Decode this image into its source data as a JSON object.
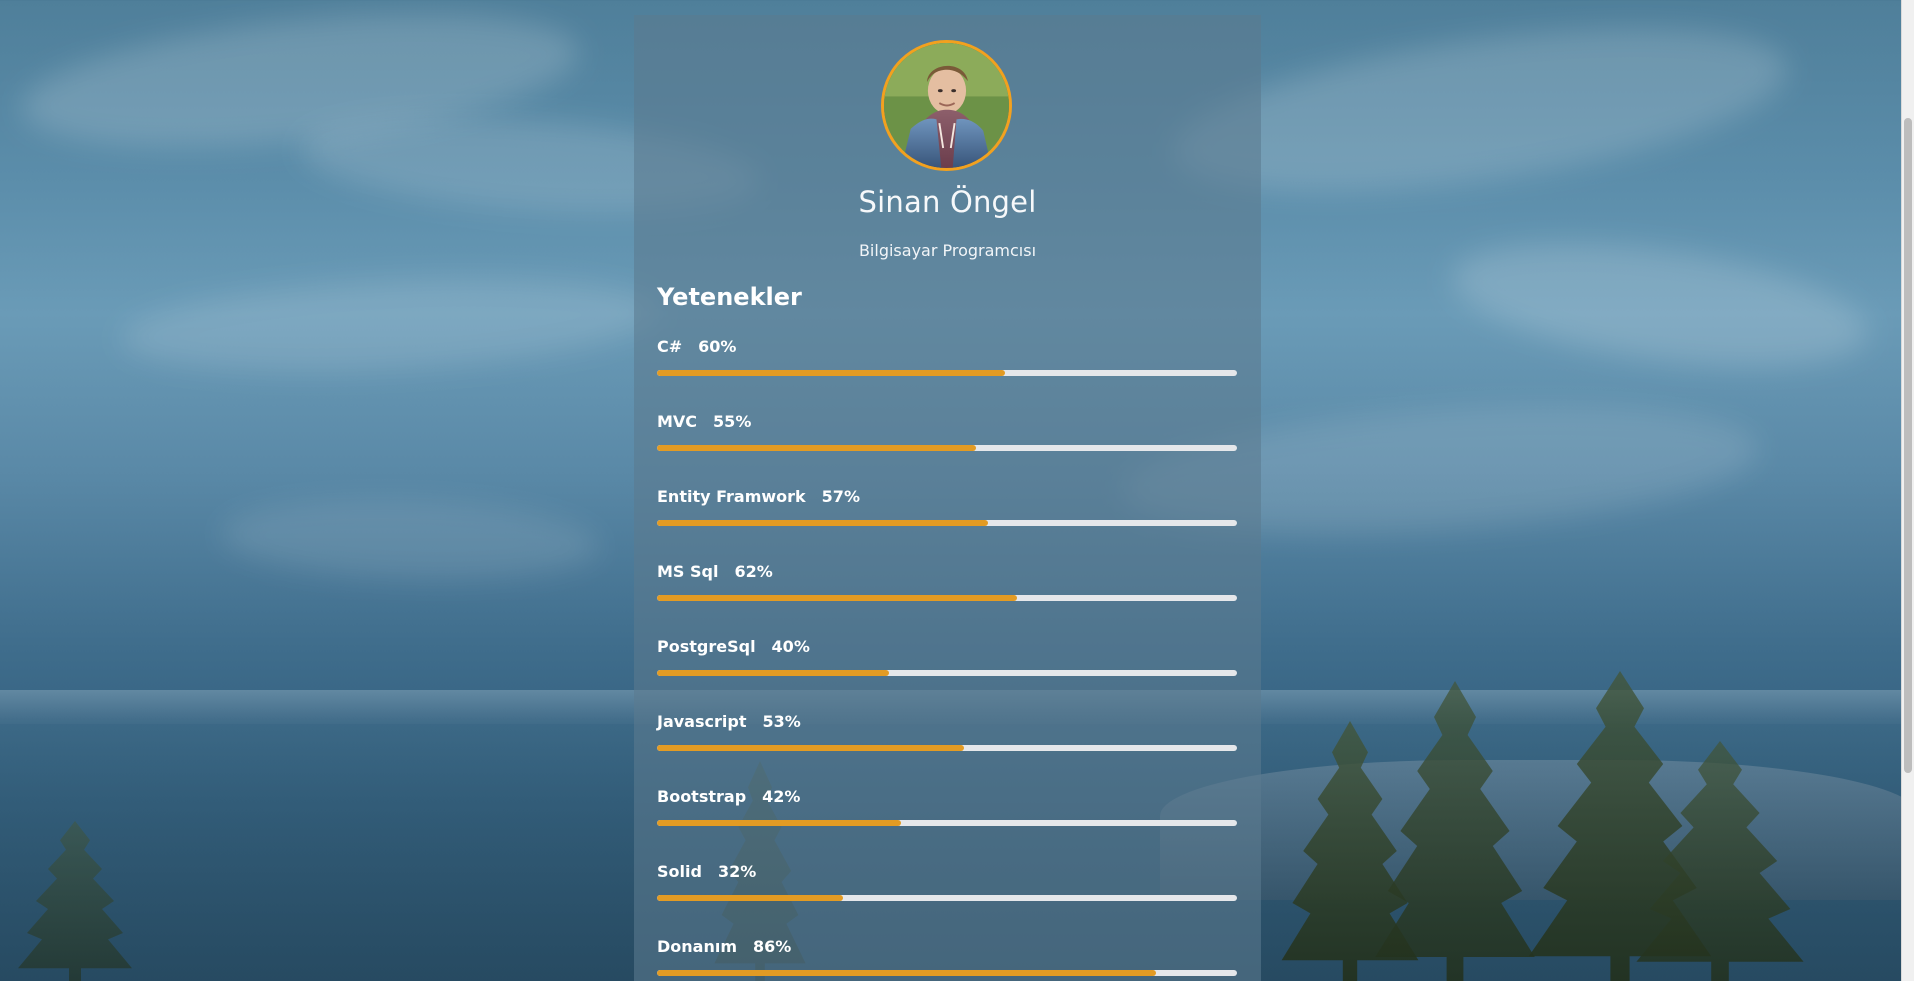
{
  "profile": {
    "name": "Sinan Öngel",
    "title": "Bilgisayar Programcısı"
  },
  "section": {
    "title": "Yetenekler"
  },
  "skills": [
    {
      "name": "C#",
      "percent_label": "60%",
      "value": 0.6
    },
    {
      "name": "MVC",
      "percent_label": "55%",
      "value": 0.55
    },
    {
      "name": "Entity Framwork",
      "percent_label": "57%",
      "value": 0.57
    },
    {
      "name": "MS Sql",
      "percent_label": "62%",
      "value": 0.62
    },
    {
      "name": "PostgreSql",
      "percent_label": "40%",
      "value": 0.4
    },
    {
      "name": "Javascript",
      "percent_label": "53%",
      "value": 0.53
    },
    {
      "name": "Bootstrap",
      "percent_label": "42%",
      "value": 0.42
    },
    {
      "name": "Solid",
      "percent_label": "32%",
      "value": 0.32
    },
    {
      "name": "Donanım",
      "percent_label": "86%",
      "value": 0.86
    }
  ],
  "colors": {
    "accent": "#e39b23",
    "avatar_border": "#f2a11f",
    "track": "#e5e7ea",
    "panel": "#5c7a8f"
  },
  "icons": {
    "avatar": "profile-photo"
  }
}
